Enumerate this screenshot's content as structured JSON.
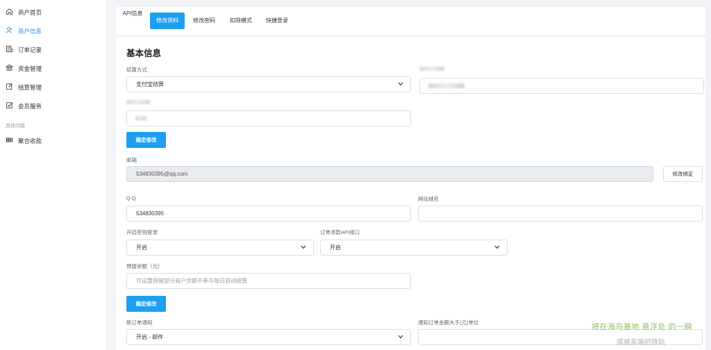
{
  "sidebar": {
    "items": [
      {
        "label": "商户首页",
        "icon": "home-icon"
      },
      {
        "label": "商户信息",
        "icon": "user-icon"
      },
      {
        "label": "订单记录",
        "icon": "list-icon"
      },
      {
        "label": "资金管理",
        "icon": "bank-icon"
      },
      {
        "label": "结算管理",
        "icon": "edit-icon"
      },
      {
        "label": "会员服务",
        "icon": "check-icon"
      }
    ],
    "group_label": "其他功能",
    "extra_items": [
      {
        "label": "聚合收款",
        "icon": "barcode-icon"
      }
    ]
  },
  "tabs": [
    "API信息",
    "修改资料",
    "修改密码",
    "扣除模式",
    "快捷登录"
  ],
  "active_tab": "修改资料",
  "form": {
    "section_title": "基本信息",
    "settle_method_label": "结算方式",
    "settle_method_value": "支付宝结算",
    "submit1": "确定修改",
    "email_label": "邮箱",
    "email_value": "534830395@qq.com",
    "change_bind": "修改绑定",
    "qq_label": "QQ",
    "qq_value": "534830395",
    "site_label": "网站域名",
    "site_value": "",
    "key_login_label": "开启密钥登录",
    "key_login_value": "开启",
    "refund_api_label": "订单退款API接口",
    "refund_api_value": "开启",
    "reserve_label": "预留余额（元）",
    "reserve_placeholder": "可设置预留部分商户余额不参与每日自动结算",
    "submit2": "确定修改",
    "notify_label": "新订单通知",
    "notify_value": "开启 - 邮件",
    "notify_amount_label": "通知订单金额大于(元)单位",
    "notify_amount_value": ""
  },
  "watermark": {
    "line1": "将在海鸟基地 悬浮处 的一瞬",
    "line2": "或被高端的铁轨"
  }
}
